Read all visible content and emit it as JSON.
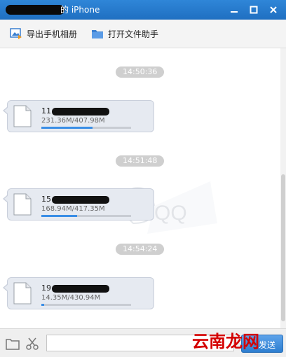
{
  "window": {
    "title": "的 iPhone",
    "buttons": {
      "minimize_icon": "minimize-icon",
      "maximize_icon": "maximize-icon",
      "close_icon": "close-icon"
    }
  },
  "toolbar": {
    "export_label": "导出手机相册",
    "open_helper_label": "打开文件助手"
  },
  "messages": [
    {
      "time": "14:50:36",
      "name_prefix": "11",
      "progress_text": "231.36M/407.98M",
      "progress": 0.57
    },
    {
      "time": "14:51:48",
      "name_prefix": "15",
      "progress_text": "168.94M/417.35M",
      "progress": 0.4
    },
    {
      "time": "14:54:24",
      "name_prefix": "19",
      "progress_text": "14.35M/430.94M",
      "progress": 0.03
    }
  ],
  "bottom": {
    "send_label": "发送",
    "input_value": ""
  },
  "watermark": "云南龙网",
  "colors": {
    "accent": "#1f6fc1",
    "progress": "#3a8ee6",
    "bubble": "#e6eaf1",
    "timestamp_bg": "#cfcfcf"
  }
}
